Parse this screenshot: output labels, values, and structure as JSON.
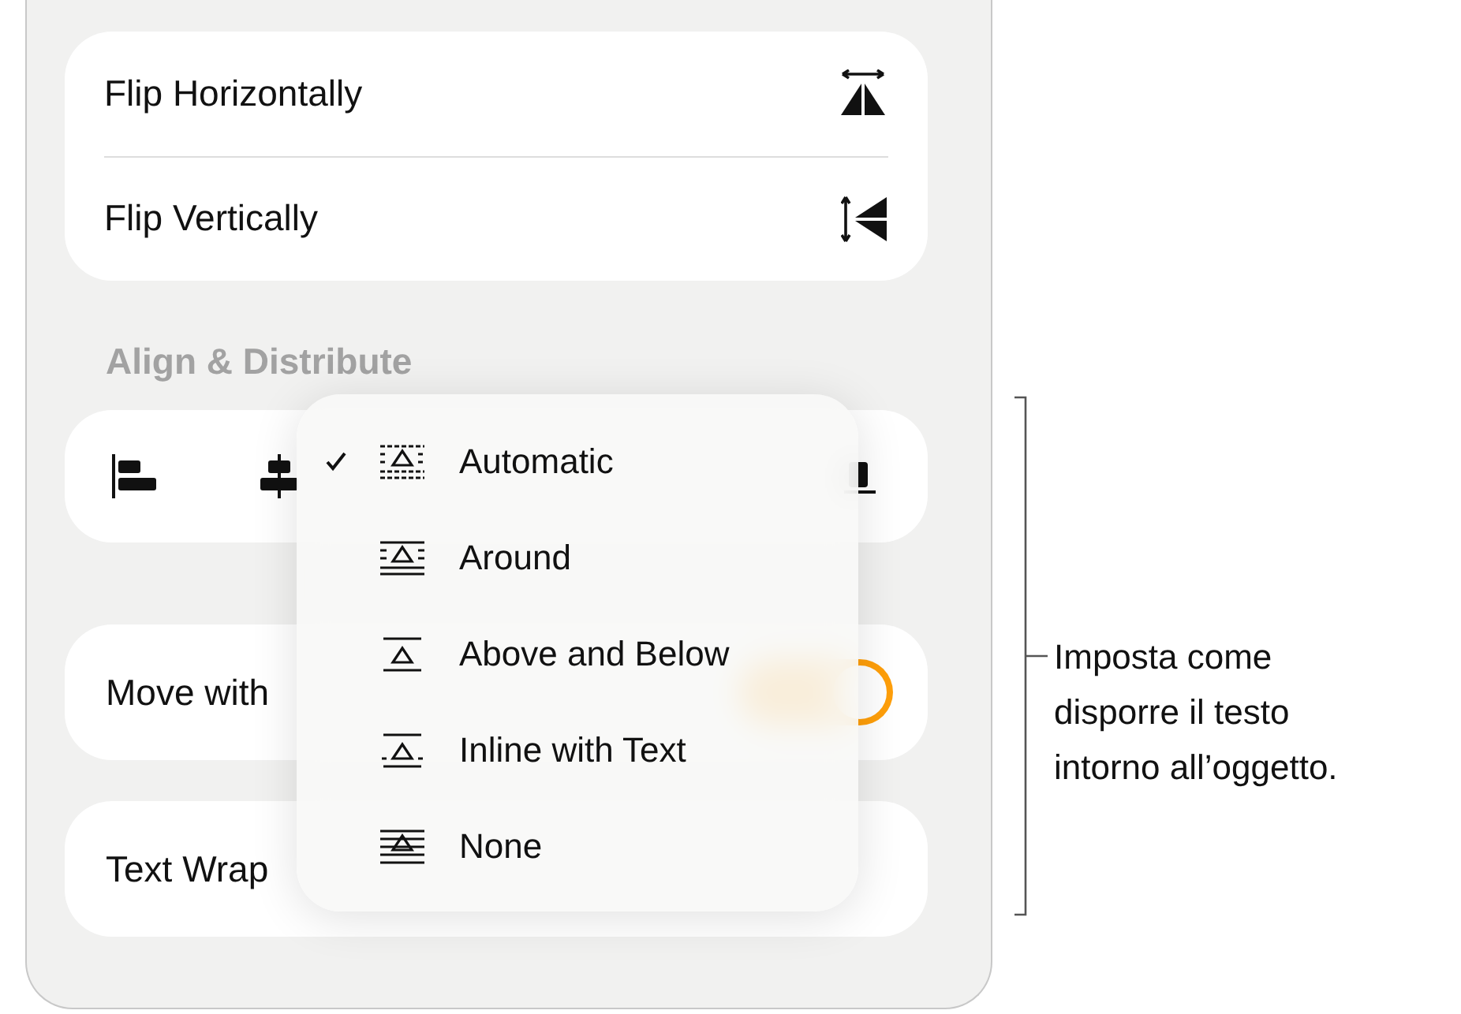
{
  "flip_options": [
    {
      "label": "Flip Horizontally",
      "kind": "horizontal"
    },
    {
      "label": "Flip Vertically",
      "kind": "vertical"
    }
  ],
  "align_section": {
    "title": "Align & Distribute",
    "buttons": [
      {
        "kind": "left"
      },
      {
        "kind": "center"
      },
      {
        "kind": "bottom"
      }
    ]
  },
  "move_with_text": {
    "label": "Move with",
    "on": true
  },
  "text_wrap": {
    "label": "Text Wrap"
  },
  "wrap_menu": [
    {
      "label": "Automatic",
      "kind": "automatic",
      "selected": true
    },
    {
      "label": "Around",
      "kind": "around",
      "selected": false
    },
    {
      "label": "Above and Below",
      "kind": "above_below",
      "selected": false
    },
    {
      "label": "Inline with Text",
      "kind": "inline",
      "selected": false
    },
    {
      "label": "None",
      "kind": "none",
      "selected": false
    }
  ],
  "callout": "Imposta come disporre il testo intorno all’oggetto."
}
